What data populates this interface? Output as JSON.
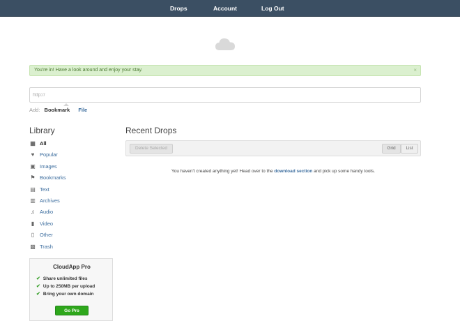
{
  "nav": {
    "drops": "Drops",
    "account": "Account",
    "logout": "Log Out"
  },
  "alert": {
    "message": "You're in! Have a look around and enjoy your stay.",
    "close": "×"
  },
  "add": {
    "placeholder": "http://",
    "label": "Add:",
    "bookmark": "Bookmark",
    "file": "File"
  },
  "library": {
    "title": "Library",
    "items": [
      {
        "label": "All",
        "icon": "grid-icon"
      },
      {
        "label": "Popular",
        "icon": "heart-icon"
      },
      {
        "label": "Images",
        "icon": "image-icon"
      },
      {
        "label": "Bookmarks",
        "icon": "bookmark-icon"
      },
      {
        "label": "Text",
        "icon": "document-icon"
      },
      {
        "label": "Archives",
        "icon": "archive-icon"
      },
      {
        "label": "Audio",
        "icon": "music-note-icon"
      },
      {
        "label": "Video",
        "icon": "film-icon"
      },
      {
        "label": "Other",
        "icon": "file-icon"
      },
      {
        "label": "Trash",
        "icon": "trash-icon"
      }
    ]
  },
  "promo": {
    "title": "CloudApp Pro",
    "features": [
      "Share unlimited files",
      "Up to 250MB per upload",
      "Bring your own domain"
    ],
    "button": "Go Pro"
  },
  "recent": {
    "title": "Recent Drops",
    "delete_label": "Delete Selected",
    "grid_label": "Grid",
    "list_label": "List",
    "empty_prefix": "You haven't created anything yet! Head over to the",
    "empty_link": "download section",
    "empty_suffix": "and pick up some handy tools."
  },
  "colors": {
    "topbar": "#3b4f63",
    "link": "#3c6d9e",
    "alert_bg": "#dbf0cf",
    "go_pro": "#2ea71b"
  }
}
